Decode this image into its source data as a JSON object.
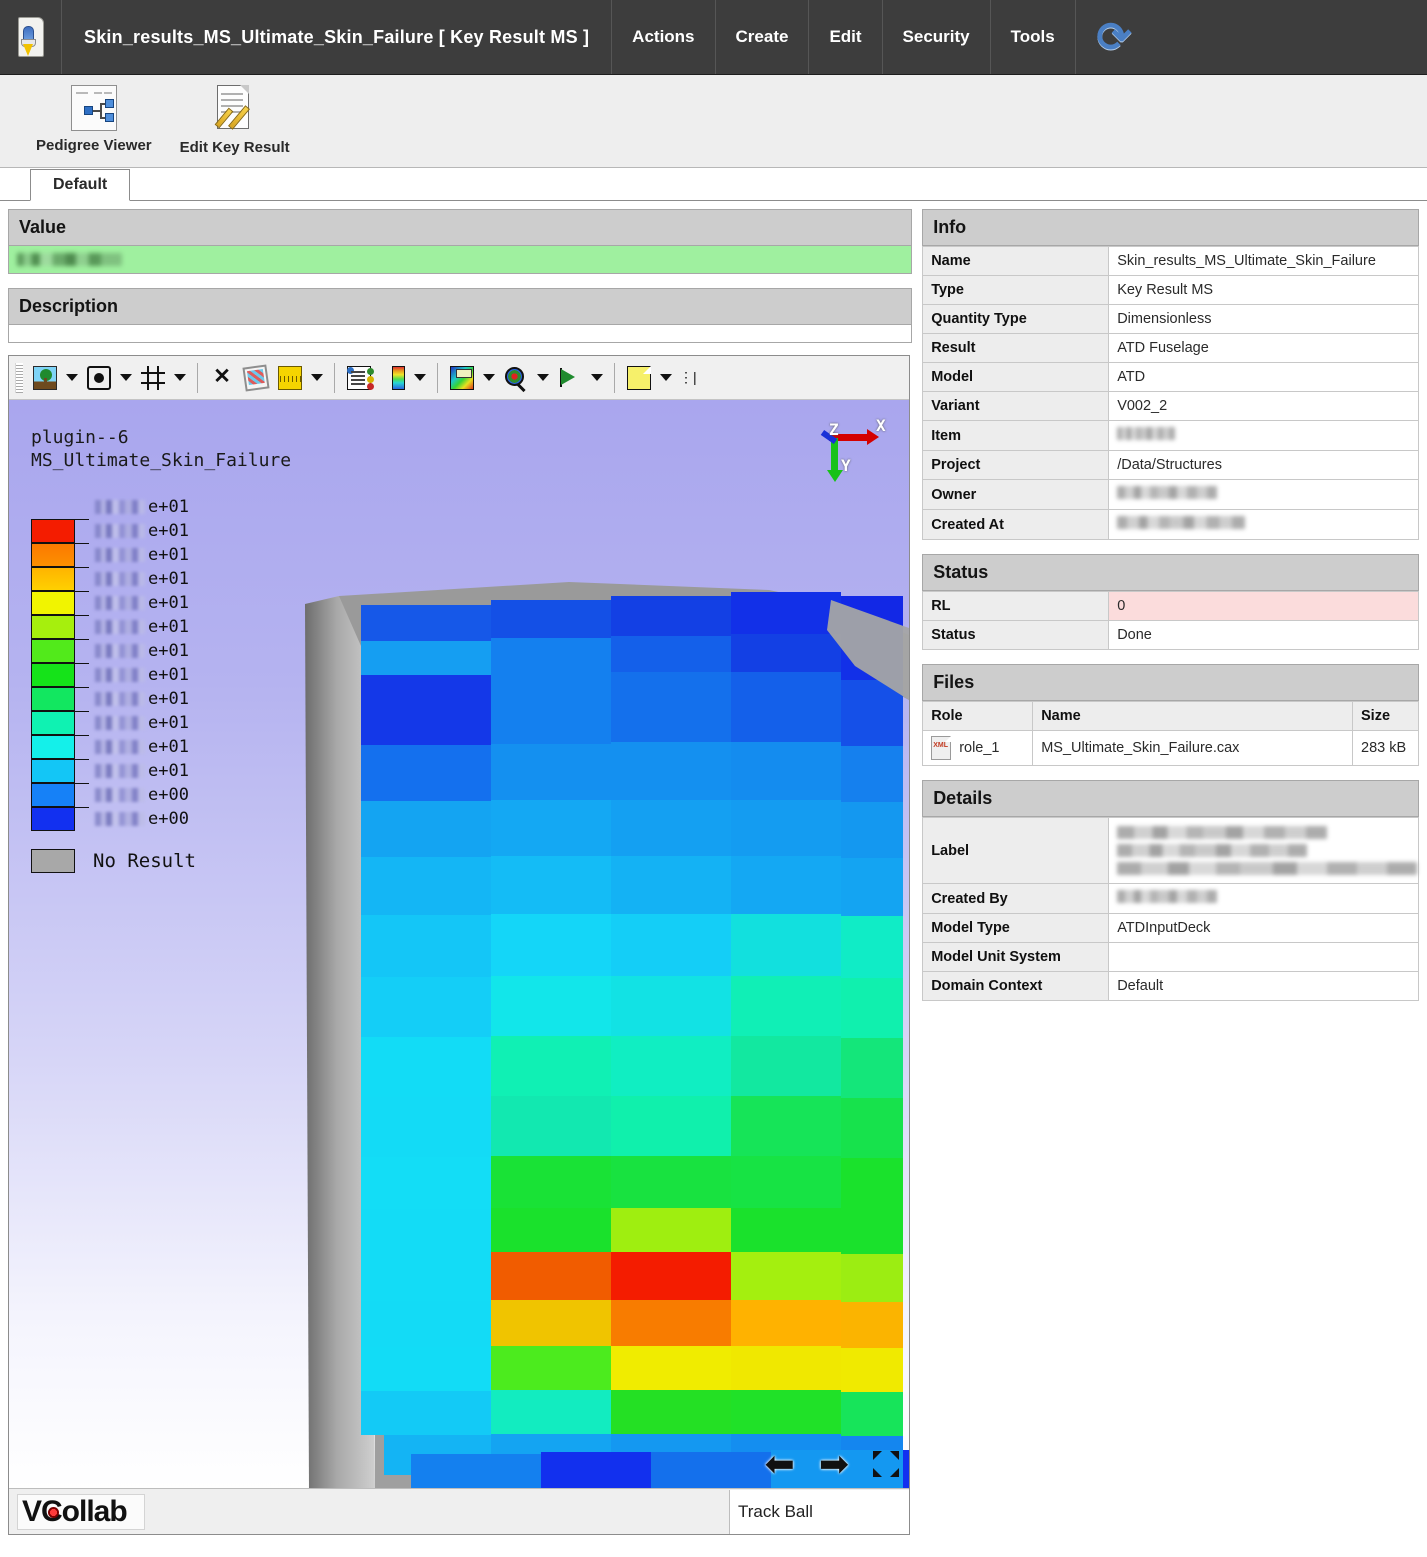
{
  "appbar": {
    "icon": "key-result-app-icon",
    "title": "Skin_results_MS_Ultimate_Skin_Failure [  Key Result MS ]",
    "menus": [
      "Actions",
      "Create",
      "Edit",
      "Security",
      "Tools"
    ],
    "refresh_icon": "refresh-icon"
  },
  "ribbon": {
    "buttons": [
      {
        "label": "Pedigree Viewer",
        "icon": "pedigree-viewer-icon"
      },
      {
        "label": "Edit Key Result",
        "icon": "edit-key-result-icon"
      }
    ]
  },
  "tabs": [
    {
      "label": "Default",
      "active": true
    }
  ],
  "value_section": {
    "header": "Value",
    "value": "",
    "redacted": true
  },
  "description_section": {
    "header": "Description",
    "text": ""
  },
  "viewer": {
    "toolbar": [
      {
        "icon": "scene-tree-icon",
        "dropdown": true
      },
      {
        "icon": "fit-view-icon",
        "dropdown": true
      },
      {
        "icon": "grid-icon",
        "dropdown": true
      },
      {
        "icon": "explode-icon",
        "dropdown": false
      },
      {
        "icon": "cube-view-icon",
        "dropdown": false
      },
      {
        "icon": "measure-icon",
        "dropdown": true
      },
      {
        "icon": "properties-icon",
        "dropdown": false
      },
      {
        "icon": "color-bar-icon",
        "dropdown": true
      },
      {
        "icon": "contour-icon",
        "dropdown": true
      },
      {
        "icon": "probe-icon",
        "dropdown": true
      },
      {
        "icon": "animate-icon",
        "dropdown": true
      },
      {
        "icon": "report-page-icon",
        "dropdown": true
      }
    ],
    "overlay_title_line1": "plugin--6",
    "overlay_title_line2": "MS_Ultimate_Skin_Failure",
    "triad": {
      "x": "X",
      "y": "Y",
      "z": "Z"
    },
    "legend": {
      "no_result_label": "No Result",
      "bands": [
        "#f41c00",
        "#fb7a00",
        "#ffb400",
        "#f1f400",
        "#a6ef0d",
        "#52ea1b",
        "#15e319",
        "#12e760",
        "#0ff2b2",
        "#14f0ea",
        "#13c6f6",
        "#1681f7",
        "#1230f0"
      ],
      "ticks": [
        {
          "value": "",
          "exponent": "e+01",
          "redacted": true
        },
        {
          "value": "",
          "exponent": "e+01",
          "redacted": true
        },
        {
          "value": "",
          "exponent": "e+01",
          "redacted": true
        },
        {
          "value": "",
          "exponent": "e+01",
          "redacted": true
        },
        {
          "value": "",
          "exponent": "e+01",
          "redacted": true
        },
        {
          "value": "",
          "exponent": "e+01",
          "redacted": true
        },
        {
          "value": "",
          "exponent": "e+01",
          "redacted": true
        },
        {
          "value": "",
          "exponent": "e+01",
          "redacted": true
        },
        {
          "value": "",
          "exponent": "e+01",
          "redacted": true
        },
        {
          "value": "",
          "exponent": "e+01",
          "redacted": true
        },
        {
          "value": "",
          "exponent": "e+01",
          "redacted": true
        },
        {
          "value": "",
          "exponent": "e+01",
          "redacted": true
        },
        {
          "value": "",
          "exponent": "e+00",
          "redacted": true
        },
        {
          "value": "",
          "exponent": "e+00",
          "redacted": true
        }
      ]
    },
    "nav": {
      "prev_icon": "arrow-left-icon",
      "next_icon": "arrow-right-icon",
      "fullscreen_icon": "fullscreen-icon"
    },
    "status": {
      "brand": "VCollab",
      "mode": "Track Ball"
    }
  },
  "info": {
    "header": "Info",
    "rows": [
      {
        "key": "Name",
        "value": "Skin_results_MS_Ultimate_Skin_Failure",
        "redacted": false
      },
      {
        "key": "Type",
        "value": "Key Result MS",
        "redacted": false
      },
      {
        "key": "Quantity Type",
        "value": "Dimensionless",
        "redacted": false
      },
      {
        "key": "Result",
        "value": "ATD Fuselage",
        "redacted": false
      },
      {
        "key": "Model",
        "value": "ATD",
        "redacted": false
      },
      {
        "key": "Variant",
        "value": "V002_2",
        "redacted": false
      },
      {
        "key": "Item",
        "value": "",
        "redacted": true,
        "blur_width": 58
      },
      {
        "key": "Project",
        "value": "/Data/Structures",
        "redacted": false
      },
      {
        "key": "Owner",
        "value": "",
        "redacted": true,
        "blur_width": 100
      },
      {
        "key": "Created At",
        "value": "",
        "redacted": true,
        "blur_width": 128
      }
    ]
  },
  "status": {
    "header": "Status",
    "rows": [
      {
        "key": "RL",
        "value": "0",
        "highlight": "#fbdcdc"
      },
      {
        "key": "Status",
        "value": "Done",
        "highlight": ""
      }
    ]
  },
  "files": {
    "header": "Files",
    "columns": [
      "Role",
      "Name",
      "Size"
    ],
    "rows": [
      {
        "role": "role_1",
        "name": "MS_Ultimate_Skin_Failure.cax",
        "size": "283 kB",
        "icon": "xml-file-icon"
      }
    ]
  },
  "details": {
    "header": "Details",
    "rows": [
      {
        "key": "Label",
        "value": "",
        "redacted": true,
        "lines": 3
      },
      {
        "key": "Created By",
        "value": "",
        "redacted": true,
        "lines": 1,
        "blur_width": 100
      },
      {
        "key": "Model Type",
        "value": "ATDInputDeck",
        "redacted": false
      },
      {
        "key": "Model Unit System",
        "value": "",
        "redacted": false
      },
      {
        "key": "Domain Context",
        "value": "Default",
        "redacted": false
      }
    ]
  },
  "colors": {
    "appbar_bg": "#3d3d3d",
    "ribbon_bg": "#eeeeee",
    "section_head_bg": "#cdcdcd",
    "value_green": "#9ff09f",
    "status_pink": "#fbdcdc",
    "viewer_bg_top": "#a9a6ee",
    "viewer_bg_bottom": "#ffffff"
  }
}
